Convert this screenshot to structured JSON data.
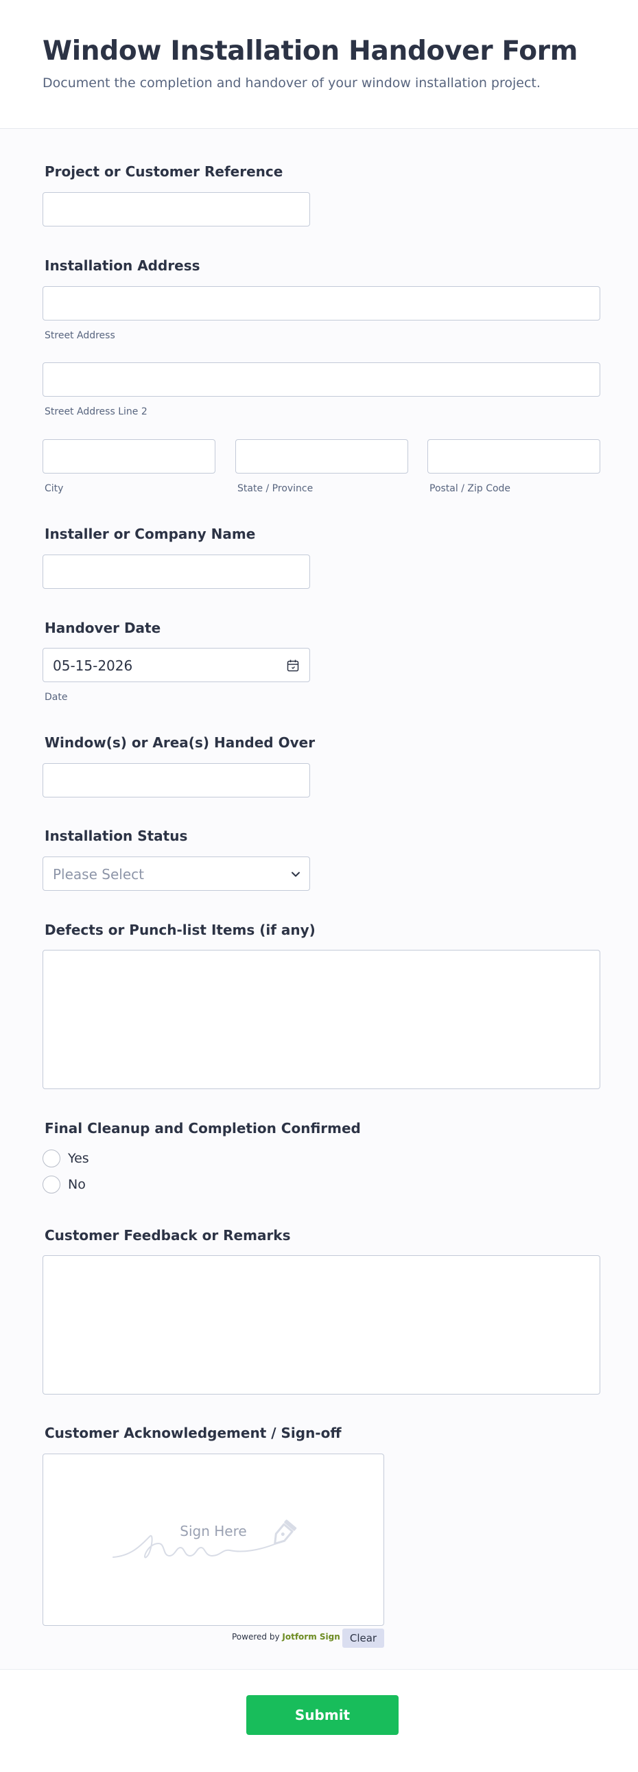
{
  "header": {
    "title": "Window Installation Handover Form",
    "subtitle": "Document the completion and handover of your window installation project."
  },
  "fields": {
    "project_reference": {
      "label": "Project or Customer Reference",
      "value": ""
    },
    "address": {
      "label": "Installation Address",
      "street_sublabel": "Street Address",
      "street2_sublabel": "Street Address Line 2",
      "city_sublabel": "City",
      "state_sublabel": "State / Province",
      "zip_sublabel": "Postal / Zip Code"
    },
    "installer": {
      "label": "Installer or Company Name",
      "value": ""
    },
    "handover_date": {
      "label": "Handover Date",
      "value": "05-15-2026",
      "sublabel": "Date",
      "icon": "calendar-icon"
    },
    "windows": {
      "label": "Window(s) or Area(s) Handed Over",
      "value": ""
    },
    "status": {
      "label": "Installation Status",
      "placeholder": "Please Select",
      "icon": "chevron-down-icon"
    },
    "defects": {
      "label": "Defects or Punch-list Items (if any)",
      "value": ""
    },
    "cleanup": {
      "label": "Final Cleanup and Completion Confirmed",
      "options": [
        "Yes",
        "No"
      ]
    },
    "feedback": {
      "label": "Customer Feedback or Remarks",
      "value": ""
    },
    "signature": {
      "label": "Customer Acknowledgement / Sign-off",
      "placeholder": "Sign Here",
      "powered_by": "Powered by",
      "brand": "Jotform Sign",
      "clear_label": "Clear"
    }
  },
  "footer": {
    "submit_label": "Submit"
  },
  "colors": {
    "accent": "#18bd5b",
    "brand": "#6c8b21",
    "text": "#2c3345",
    "border": "#c3cad8"
  }
}
